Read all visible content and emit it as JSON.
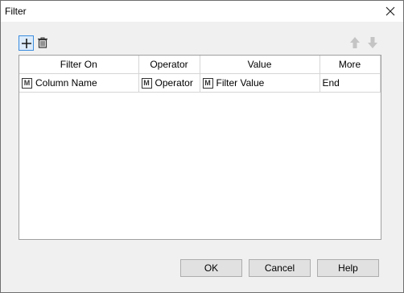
{
  "window": {
    "title": "Filter",
    "close_icon": "close-icon"
  },
  "toolbar": {
    "add_icon": "plus-icon",
    "delete_icon": "trash-icon",
    "up_icon": "arrow-up-icon",
    "down_icon": "arrow-down-icon"
  },
  "table": {
    "headers": [
      "Filter On",
      "Operator",
      "Value",
      "More"
    ],
    "rows": [
      {
        "filter_on": "Column Name",
        "operator": "Operator",
        "value": "Filter Value",
        "more": "End",
        "badge": "M"
      }
    ]
  },
  "buttons": {
    "ok": "OK",
    "cancel": "Cancel",
    "help": "Help"
  },
  "colors": {
    "accent_border": "#3c8dde",
    "accent_fill": "#dcebfb",
    "disabled_arrow": "#c4c4c4"
  }
}
